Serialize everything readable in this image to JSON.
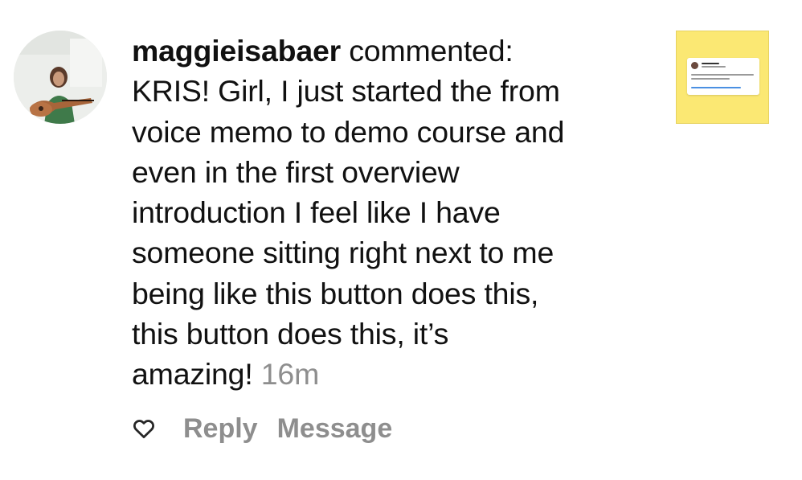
{
  "comment": {
    "username": "maggieisabaer",
    "action": "commented:",
    "lines": [
      "KRIS! Girl, I just started the from",
      "voice memo to demo course and",
      "even in the first overview",
      "introduction I feel like I have",
      "someone sitting right next to me",
      "being like this button does this,",
      "this button does this, it’s",
      "amazing!"
    ],
    "timestamp": "16m"
  },
  "actions": {
    "like_icon": "heart-outline-icon",
    "reply_label": "Reply",
    "message_label": "Message"
  },
  "post_thumbnail": {
    "background_color": "#fbe873"
  },
  "colors": {
    "text": "#111111",
    "muted": "#8e8e8e"
  }
}
